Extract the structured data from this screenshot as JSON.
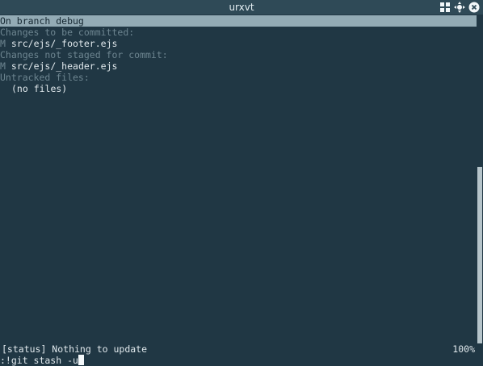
{
  "window": {
    "title": "urxvt"
  },
  "wm_icons": [
    "grid-icon",
    "move-icon",
    "close-icon"
  ],
  "terminal": {
    "lines": [
      {
        "text": "On branch debug",
        "style": "head"
      },
      {
        "text": "Changes to be committed:",
        "style": "muted"
      },
      {
        "marker": "M",
        "text": "src/ejs/_footer.ejs",
        "style": "file"
      },
      {
        "text": "Changes not staged for commit:",
        "style": "muted"
      },
      {
        "marker": "M",
        "text": "src/ejs/_header.ejs",
        "style": "file"
      },
      {
        "text": "Untracked files:",
        "style": "muted"
      },
      {
        "text": "(no files)",
        "style": "indent"
      }
    ]
  },
  "status": {
    "left": "[status] Nothing to update",
    "right": "100%"
  },
  "prompt": {
    "text": ":!git stash -u"
  },
  "colors": {
    "background": "#203744",
    "titlebar": "#2f4a57",
    "highlight": "#93abb5",
    "muted": "#6d8590",
    "foreground": "#e0e8ec"
  }
}
